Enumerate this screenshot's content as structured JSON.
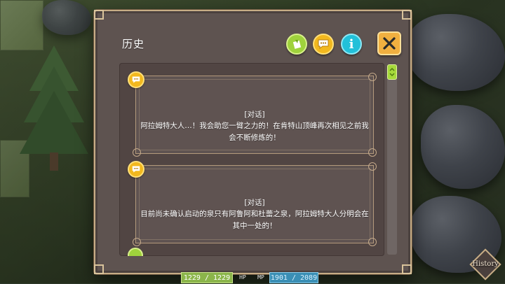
{
  "window": {
    "title": "历史"
  },
  "header_buttons": {
    "filter_icon": "flag-note-icon",
    "chat_icon": "speech-bubble-icon",
    "info_label": "i",
    "close_icon": "close-x-icon"
  },
  "entries": [
    {
      "icon": "speech-bubble-icon",
      "tag": "[对话]",
      "text": "阿拉姆特大人…！我会助您一臂之力的！在肯特山顶峰再次相见之前我\n会不断修炼的！"
    },
    {
      "icon": "speech-bubble-icon",
      "tag": "[对话]",
      "text": "目前尚未确认启动的泉只有阿鲁阿和杜蕾之泉，阿拉姆特大人分明会在\n其中一处的！"
    }
  ],
  "hud": {
    "hp_value": "1229 / 1229",
    "hp_label": "HP",
    "mp_label": "MP",
    "mp_value": "1901 / 2089"
  },
  "history_button": {
    "label": "History"
  },
  "colors": {
    "panel": "#5e5350",
    "border": "#c7ad86",
    "accent_yellow": "#f2b81e",
    "accent_green": "#9fd23c",
    "accent_cyan": "#22c0d9",
    "close_orange": "#f1b040"
  }
}
